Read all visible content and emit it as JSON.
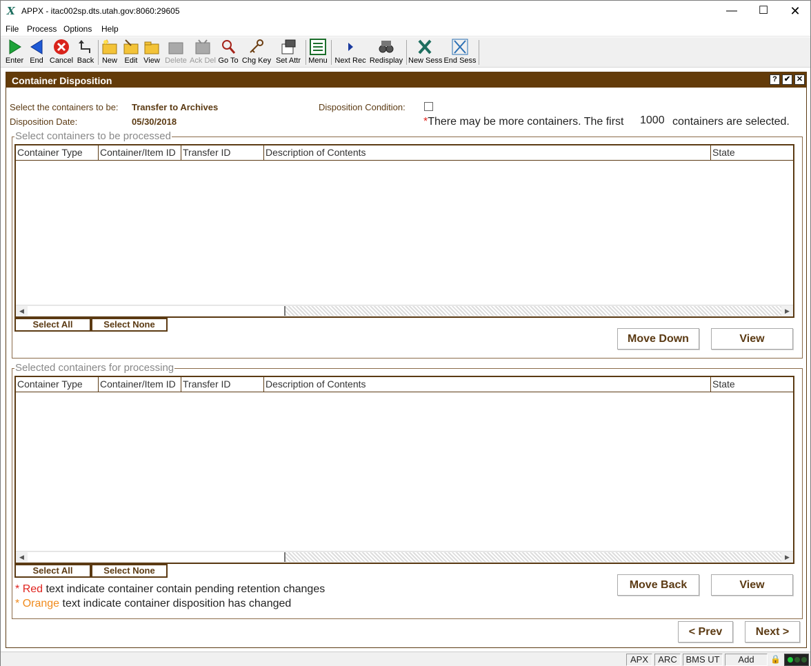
{
  "window": {
    "title": "APPX - itac002sp.dts.utah.gov:8060:29605",
    "app_icon": "appx-logo-icon",
    "controls": [
      "minimize",
      "maximize",
      "close"
    ]
  },
  "menu": [
    "File",
    "Process",
    "Options",
    "Help"
  ],
  "toolbar": [
    {
      "label": "Enter",
      "icon": "play-green-icon",
      "enabled": true
    },
    {
      "label": "End",
      "icon": "back-blue-arrow-icon",
      "enabled": true
    },
    {
      "label": "Cancel",
      "icon": "cancel-red-x-icon",
      "enabled": true
    },
    {
      "label": "Back",
      "icon": "back-curved-arrow-icon",
      "enabled": true
    },
    {
      "label": "New",
      "icon": "new-folder-icon",
      "enabled": true
    },
    {
      "label": "Edit",
      "icon": "edit-folder-icon",
      "enabled": true
    },
    {
      "label": "View",
      "icon": "view-folder-icon",
      "enabled": true
    },
    {
      "label": "Delete",
      "icon": "delete-icon",
      "enabled": false
    },
    {
      "label": "Ack Del",
      "icon": "ack-delete-icon",
      "enabled": false
    },
    {
      "label": "Go To",
      "icon": "magnifier-icon",
      "enabled": true
    },
    {
      "label": "Chg Key",
      "icon": "key-icon",
      "enabled": true
    },
    {
      "label": "Set Attr",
      "icon": "set-attributes-icon",
      "enabled": true
    },
    {
      "label": "Menu",
      "icon": "menu-list-icon",
      "enabled": true
    },
    {
      "label": "Next Rec",
      "icon": "next-record-arrow-icon",
      "enabled": true
    },
    {
      "label": "Redisplay",
      "icon": "binoculars-icon",
      "enabled": true
    },
    {
      "label": "New Sess",
      "icon": "new-session-icon",
      "enabled": true
    },
    {
      "label": "End Sess",
      "icon": "end-session-icon",
      "enabled": true
    }
  ],
  "panel": {
    "title": "Container Disposition",
    "header_buttons": [
      "?",
      "✔",
      "✕"
    ]
  },
  "form": {
    "select_label": "Select the containers to be:",
    "select_value": "Transfer to Archives",
    "date_label": "Disposition Date:",
    "date_value": "05/30/2018",
    "condition_label": "Disposition Condition:",
    "condition_checked": false,
    "more_note_prefix": "*",
    "more_note_text": "There may be more containers. The first",
    "count": "1000",
    "more_note_suffix": "containers are selected."
  },
  "group_top": {
    "legend": "Select containers to be processed",
    "columns": [
      "Container Type",
      "Container/Item ID",
      "Transfer ID",
      "Description of Contents",
      "State"
    ],
    "rows": [],
    "select_all": "Select All",
    "select_none": "Select None",
    "move_button": "Move Down",
    "view_button": "View"
  },
  "group_bottom": {
    "legend": "Selected containers for processing",
    "columns": [
      "Container Type",
      "Container/Item ID",
      "Transfer ID",
      "Description of Contents",
      "State"
    ],
    "rows": [],
    "select_all": "Select All",
    "select_none": "Select None",
    "move_button": "Move Back",
    "view_button": "View"
  },
  "legend_notes": {
    "red_star": "*",
    "red_word": "Red",
    "red_rest": "text indicate container contain pending retention changes",
    "orange_star": "*",
    "orange_word": "Orange",
    "orange_rest": "text indicate container disposition has changed"
  },
  "nav": {
    "prev": "< Prev",
    "next": "Next >"
  },
  "status": [
    "APX",
    "ARC",
    "BMS UT",
    "Add"
  ],
  "colors": {
    "brand_brown": "#633b09",
    "label_brown": "#5b3a13",
    "red": "#e0231e",
    "orange": "#f08a1c"
  }
}
